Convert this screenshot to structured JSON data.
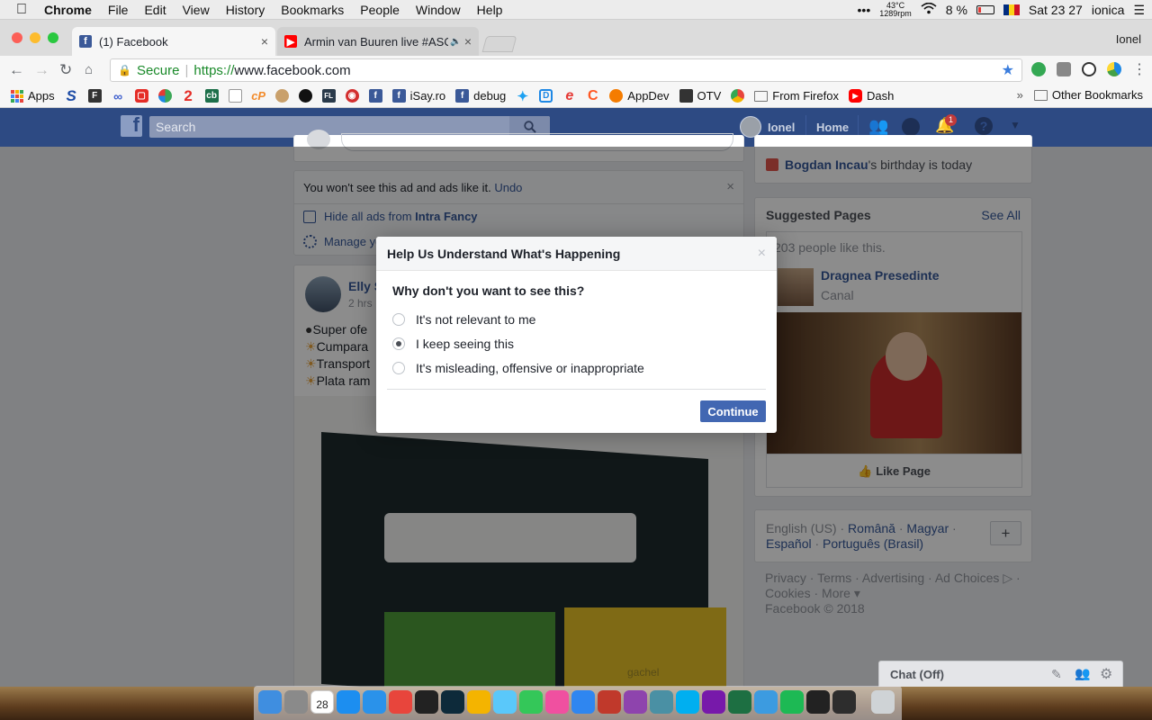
{
  "menubar": {
    "apple": "",
    "app": "Chrome",
    "items": [
      "File",
      "Edit",
      "View",
      "History",
      "Bookmarks",
      "People",
      "Window",
      "Help"
    ],
    "dots": "•••",
    "temp": "43°C",
    "rpm": "1289rpm",
    "battery": "8 %",
    "clock": "Sat 23 27",
    "user": "ionica"
  },
  "tabs": [
    {
      "title": "(1) Facebook",
      "icon": "facebook-icon",
      "color": "#3b5998"
    },
    {
      "title": "Armin van Buuren live #ASO",
      "icon": "youtube-icon",
      "color": "#ff0000"
    }
  ],
  "profile": "Ionel",
  "address": {
    "secure": "Secure",
    "scheme": "https://",
    "host": "www.facebook.com"
  },
  "bookmarks": [
    {
      "label": "Apps",
      "icon": "apps-grid-icon",
      "color": "#e8453c"
    },
    {
      "label": "",
      "icon": "s-icon",
      "color": "#1b4aa5"
    },
    {
      "label": "",
      "icon": "ftp-icon",
      "color": "#333"
    },
    {
      "label": "",
      "icon": "link-icon",
      "color": "#3b5ccc"
    },
    {
      "label": "",
      "icon": "square-icon",
      "color": "#e52d27"
    },
    {
      "label": "",
      "icon": "pie-icon",
      "color": "#3aa757"
    },
    {
      "label": "",
      "icon": "two-icon",
      "color": "#e52d27"
    },
    {
      "label": "",
      "icon": "cb-icon",
      "color": "#1d6f4a"
    },
    {
      "label": "",
      "icon": "doc-icon",
      "color": "#999"
    },
    {
      "label": "",
      "icon": "cp-icon",
      "color": "#f28b2b"
    },
    {
      "label": "",
      "icon": "badge-icon",
      "color": "#aa5533"
    },
    {
      "label": "",
      "icon": "github-icon",
      "color": "#111"
    },
    {
      "label": "",
      "icon": "fl-icon",
      "color": "#2a3a4a"
    },
    {
      "label": "",
      "icon": "target-icon",
      "color": "#d32f2f"
    },
    {
      "label": "",
      "icon": "facebook-icon",
      "color": "#3b5998"
    },
    {
      "label": "iSay.ro",
      "icon": "facebook-icon",
      "color": "#3b5998"
    },
    {
      "label": "debug",
      "icon": "facebook-icon",
      "color": "#3b5998"
    },
    {
      "label": "",
      "icon": "twitter-icon",
      "color": "#1da1f2"
    },
    {
      "label": "",
      "icon": "d-icon",
      "color": "#1e88e5"
    },
    {
      "label": "",
      "icon": "e-icon",
      "color": "#e53935"
    },
    {
      "label": "",
      "icon": "c-icon",
      "color": "#ff5722"
    },
    {
      "label": "AppDev",
      "icon": "orange-circle-icon",
      "color": "#f57c00"
    },
    {
      "label": "OTV",
      "icon": "tv-icon",
      "color": "#333"
    },
    {
      "label": "",
      "icon": "chrome-icon",
      "color": "#4285f4"
    },
    {
      "label": "From Firefox",
      "icon": "folder-icon",
      "color": "#888"
    },
    {
      "label": "Dash",
      "icon": "youtube-icon",
      "color": "#ff0000"
    }
  ],
  "bookmarks_more": "»",
  "bookmarks_other": "Other Bookmarks",
  "fb": {
    "logo": "f",
    "search_placeholder": "Search",
    "user": "Ionel",
    "home": "Home",
    "notif_count": "1",
    "hidden_ad": {
      "text": "You won't see this ad and ads like it.",
      "undo": "Undo",
      "hide_all_prefix": "Hide all ads from",
      "hide_all_name": "Intra Fancy",
      "manage": "Manage yo"
    },
    "post": {
      "author": "Elly S",
      "time": "2 hrs",
      "lines": [
        "Super ofe",
        "Cumpara",
        "Transport",
        "Plata ram"
      ],
      "img_text": "gachel"
    },
    "birthday": {
      "name": "Bogdan Incau",
      "rest": "'s birthday is today"
    },
    "suggested": {
      "title": "Suggested Pages",
      "see_all": "See All",
      "likes": "203 people like this.",
      "page_name": "Dragnea Presedinte",
      "page_cat": "Canal",
      "like_btn": "Like Page"
    },
    "languages": {
      "line1": [
        "English (US)",
        "Română",
        "Magyar"
      ],
      "line2": [
        "Español",
        "Português (Brasil)"
      ],
      "plus": "+"
    },
    "footer": {
      "line1": [
        "Privacy",
        "Terms",
        "Advertising",
        "Ad Choices"
      ],
      "line2": [
        "Cookies",
        "More"
      ],
      "copyright": "Facebook © 2018"
    },
    "chat": "Chat (Off)"
  },
  "modal": {
    "title": "Help Us Understand What's Happening",
    "close": "×",
    "question": "Why don't you want to see this?",
    "options": [
      {
        "label": "It's not relevant to me",
        "selected": false
      },
      {
        "label": "I keep seeing this",
        "selected": true
      },
      {
        "label": "It's misleading, offensive or inappropriate",
        "selected": false
      }
    ],
    "continue": "Continue"
  },
  "dock": {
    "calendar_day": "28",
    "apps": [
      {
        "name": "finder-icon",
        "color": "#3f8ee0"
      },
      {
        "name": "launchpad-icon",
        "color": "#8a8a8a"
      },
      {
        "name": "calendar-icon",
        "color": "#ffffff"
      },
      {
        "name": "app-store-icon",
        "color": "#1c8ef0"
      },
      {
        "name": "safari-icon",
        "color": "#2a92ea"
      },
      {
        "name": "chrome-icon",
        "color": "#e8453c"
      },
      {
        "name": "final-cut-icon",
        "color": "#222222"
      },
      {
        "name": "photoshop-icon",
        "color": "#0d2a3a"
      },
      {
        "name": "photos-icon",
        "color": "#f4b400"
      },
      {
        "name": "messages-icon",
        "color": "#5ac8fa"
      },
      {
        "name": "facetime-icon",
        "color": "#34c759"
      },
      {
        "name": "itunes-icon",
        "color": "#f050a0"
      },
      {
        "name": "app-store-icon",
        "color": "#2f86f0"
      },
      {
        "name": "photo-booth-icon",
        "color": "#c0392b"
      },
      {
        "name": "color-picker-icon",
        "color": "#8e44ad"
      },
      {
        "name": "disk-utility-icon",
        "color": "#4a90a4"
      },
      {
        "name": "skype-icon",
        "color": "#00aff0"
      },
      {
        "name": "onenote-icon",
        "color": "#7719aa"
      },
      {
        "name": "excel-icon",
        "color": "#1d6f42"
      },
      {
        "name": "preview-icon",
        "color": "#3c9be0"
      },
      {
        "name": "spotify-icon",
        "color": "#1db954"
      },
      {
        "name": "terminal-icon",
        "color": "#222222"
      },
      {
        "name": "activity-monitor-icon",
        "color": "#2d2d2d"
      },
      {
        "name": "trash-icon",
        "color": "#cfd3d6"
      }
    ]
  }
}
